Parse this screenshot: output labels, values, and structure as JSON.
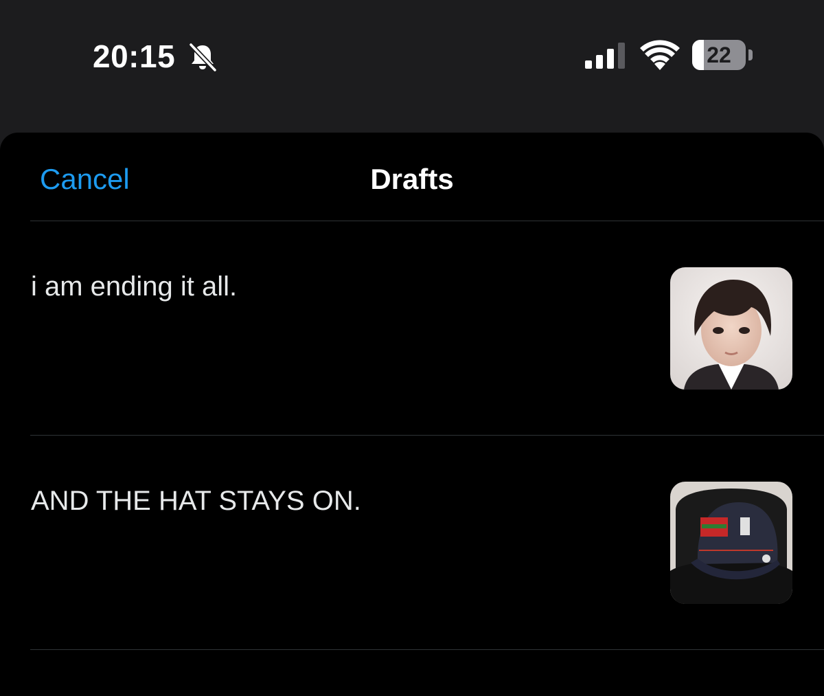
{
  "status_bar": {
    "time": "20:15",
    "silent_icon": "bell-slash-icon",
    "signal_icon": "cellular-signal-icon",
    "wifi_icon": "wifi-icon",
    "battery_percent": "22",
    "battery_level": 0.22
  },
  "header": {
    "cancel_label": "Cancel",
    "title": "Drafts",
    "accent_color": "#1d9bf0"
  },
  "drafts": [
    {
      "text": "i am ending it all.",
      "thumbnail": "portrait-photo"
    },
    {
      "text": "AND THE HAT STAYS ON.",
      "thumbnail": "cap-photo"
    }
  ]
}
